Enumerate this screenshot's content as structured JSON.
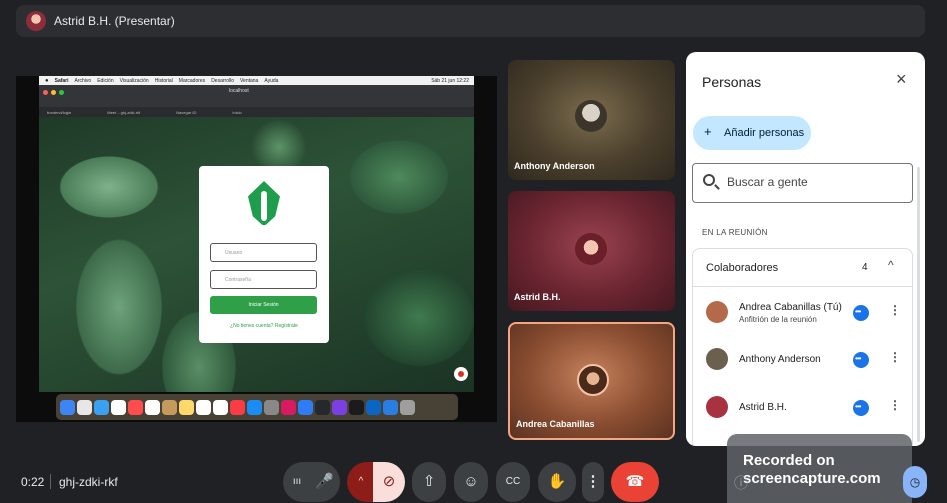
{
  "presenter_bar": {
    "title": "Astrid B.H. (Presentar)"
  },
  "shared_screen": {
    "menubar": {
      "apple": "",
      "items": [
        "Safari",
        "Archivo",
        "Edición",
        "Visualización",
        "Historial",
        "Marcadores",
        "Desarrollo",
        "Ventana",
        "Ayuda"
      ],
      "clock": "Sáb 21 jun 12:22"
    },
    "browser_url": "localhost",
    "browser_tabs": [
      "frontend/login",
      "Meet – ghj-zdki-rkf",
      "Navegar ID",
      "Inicio"
    ],
    "login_card": {
      "username_placeholder": "Usuario",
      "password_placeholder": "Contraseña",
      "login_button": "Iniciar Sesión",
      "register_link": "¿No tienes cuenta? Regístrate"
    },
    "dock_colors": [
      "#3d85f5",
      "#e7e7e7",
      "#3aa0f2",
      "#ffffff",
      "#ff4d4d",
      "#ffffff",
      "#c59a5b",
      "#ffd86b",
      "#ffffff",
      "#ffffff",
      "#fc3c44",
      "#1b8cf5",
      "#888888",
      "#d81b60",
      "#2e7df6",
      "#24292e",
      "#7b3fe4",
      "#1b1b1b",
      "#0a66c2",
      "#2a7de1",
      "#9e9e9e"
    ]
  },
  "tiles": [
    {
      "name": "Anthony Anderson"
    },
    {
      "name": "Astrid B.H."
    },
    {
      "name": "Andrea Cabanillas"
    }
  ],
  "people_panel": {
    "title": "Personas",
    "close_icon": "×",
    "add_people_icon": "+",
    "add_people_label": "Añadir personas",
    "search_placeholder": "Buscar a gente",
    "section_label": "EN LA REUNIÓN",
    "group": {
      "label": "Colaboradores",
      "count": "4",
      "chevron": "^"
    },
    "participants": [
      {
        "name": "Andrea Cabanillas (Tú)",
        "subtitle": "Anfitrión de la reunión",
        "avatar_color": "#b46a4a"
      },
      {
        "name": "Anthony Anderson",
        "subtitle": "",
        "avatar_color": "#6b5f4d"
      },
      {
        "name": "Astrid B.H.",
        "subtitle": "",
        "avatar_color": "#a8323f"
      }
    ],
    "more_icon": "⋮"
  },
  "watermark": {
    "line1": "Recorded on",
    "line2": "screencapture.com"
  },
  "bottom_bar": {
    "time": "0:22",
    "meeting_code": "ghj-zdki-rkf",
    "audio_indicator": "ııı",
    "mic_icon": "🎤",
    "cam_options_icon": "^",
    "cam_off_icon": "⊘",
    "present_icon": "⇧",
    "emoji_icon": "☺",
    "captions_icon": "CC",
    "hand_icon": "✋",
    "more_icon": "⋮",
    "leave_icon": "☎",
    "info_icon": "ⓘ",
    "activities_icon": "◷"
  }
}
